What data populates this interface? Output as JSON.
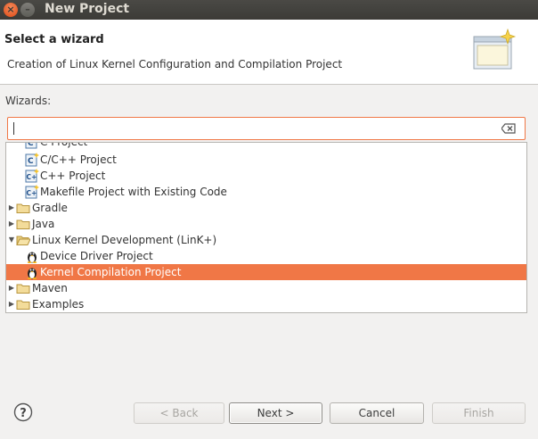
{
  "window": {
    "title": "New Project"
  },
  "header": {
    "title": "Select a wizard",
    "description": "Creation of Linux Kernel Configuration and Compilation Project"
  },
  "wizards_label": "Wizards:",
  "filter": {
    "value": ""
  },
  "tree": [
    {
      "label": "C Project",
      "icon": "c-project-icon"
    },
    {
      "label": "C/C++ Project",
      "icon": "c-project-icon"
    },
    {
      "label": "C++ Project",
      "icon": "cpp-project-icon"
    },
    {
      "label": "Makefile Project with Existing Code",
      "icon": "cpp-project-icon"
    },
    {
      "label": "Gradle",
      "icon": "folder-icon",
      "expanded": false
    },
    {
      "label": "Java",
      "icon": "folder-icon",
      "expanded": false
    },
    {
      "label": "Linux Kernel Development (LinK+)",
      "icon": "folder-open-icon",
      "expanded": true
    },
    {
      "label": "Device Driver Project",
      "icon": "tux-icon"
    },
    {
      "label": "Kernel Compilation Project",
      "icon": "tux-icon",
      "selected": true
    },
    {
      "label": "Maven",
      "icon": "folder-icon",
      "expanded": false
    },
    {
      "label": "Examples",
      "icon": "folder-icon",
      "expanded": false
    }
  ],
  "buttons": {
    "back": "< Back",
    "next": "Next >",
    "cancel": "Cancel",
    "finish": "Finish"
  },
  "colors": {
    "selection": "#f07746",
    "close": "#df4a16"
  }
}
